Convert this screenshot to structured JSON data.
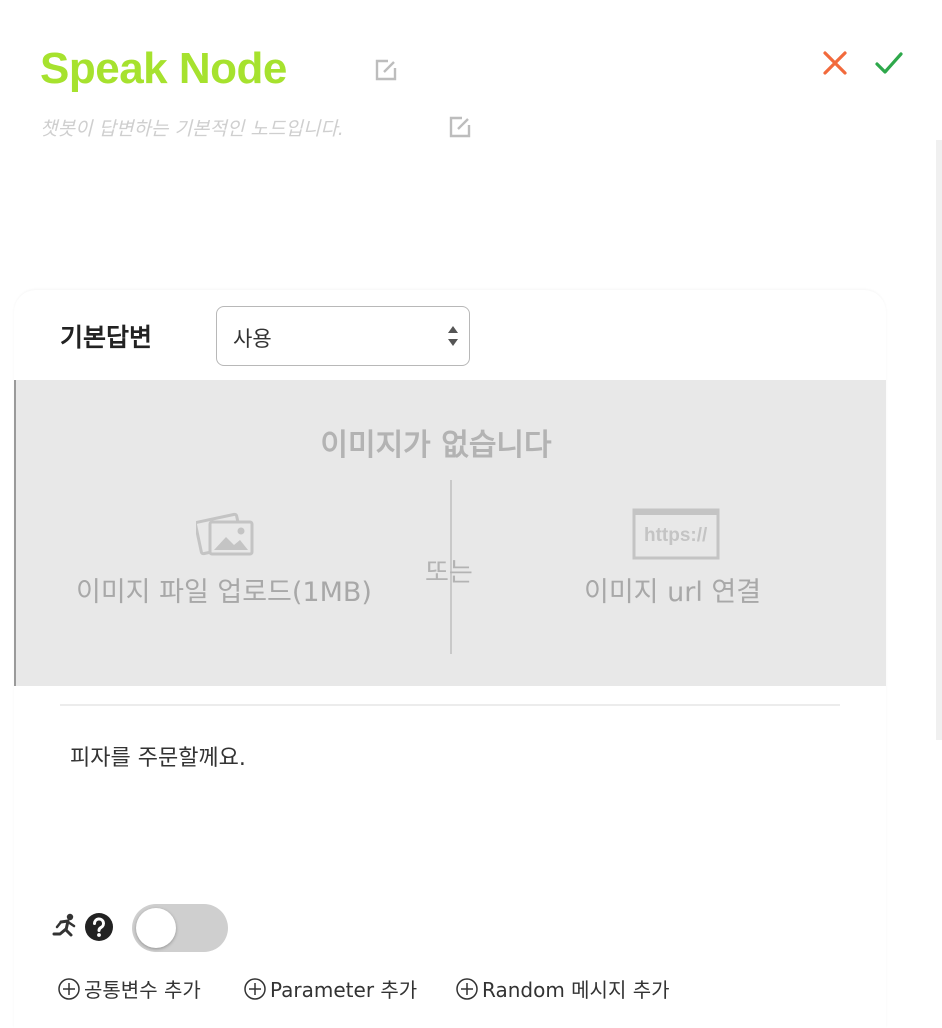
{
  "header": {
    "title": "Speak Node",
    "subtitle": "챗봇이 답변하는 기본적인 노드입니다.",
    "title_color": "#a6e22e",
    "cancel_icon": "close-icon",
    "confirm_icon": "check-icon",
    "cancel_color": "#f26a3c",
    "confirm_color": "#2ea84b"
  },
  "answer": {
    "label": "기본답변",
    "select_value": "사용"
  },
  "image": {
    "empty_text": "이미지가 없습니다",
    "or_text": "또는",
    "upload_label": "이미지 파일 업로드(1MB)",
    "url_label": "이미지 url 연결",
    "url_icon_text": "https://"
  },
  "message": {
    "text": "피자를 주문할께요."
  },
  "footer": {
    "toggle_on": false,
    "add_common_variable": "공통변수 추가",
    "add_parameter": "Parameter 추가",
    "add_random_message": "Random 메시지 추가"
  }
}
